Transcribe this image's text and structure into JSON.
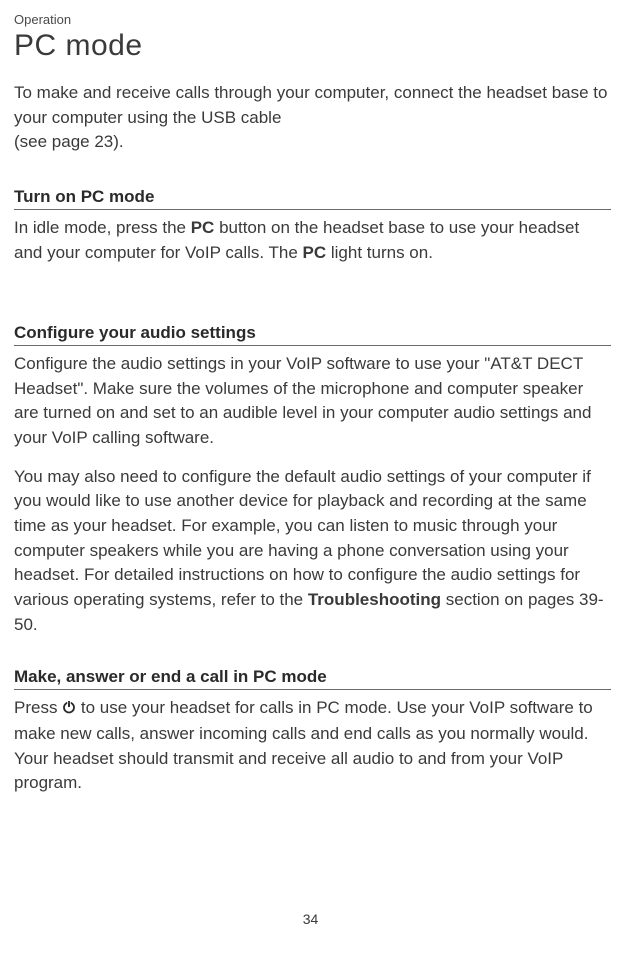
{
  "header": {
    "category": "Operation",
    "title": "PC mode"
  },
  "intro": "To make and receive calls through your computer, connect the headset base to your computer using the USB cable \n(see page 23).",
  "sections": {
    "turn_on": {
      "heading": "Turn on PC mode",
      "text_pre1": "In idle mode, press the ",
      "bold1": "PC",
      "text_mid": " button on the headset base to use your headset and your computer for VoIP calls. The ",
      "bold2": "PC",
      "text_post": " light turns on."
    },
    "configure": {
      "heading": "Configure your audio settings",
      "p1": "Configure the audio settings in your VoIP software to use your \"AT&T DECT Headset\". Make sure the volumes of the microphone and computer speaker are turned on and set to an audible level in your computer audio settings and your VoIP calling software.",
      "p2_pre": "You may also need to configure the default audio settings of your computer if you would like to use another device for playback and recording at the same time as your headset. For example, you can listen to music through your computer speakers while you are having a phone conversation using your headset. For detailed instructions on how to configure the audio settings for various operating systems, refer to the ",
      "p2_bold": "Troubleshooting",
      "p2_post": " section on pages 39-50."
    },
    "make_call": {
      "heading": "Make, answer or end a call in PC mode",
      "text_pre": "Press ",
      "text_post": " to use your headset for calls in PC mode. Use your VoIP software to make new calls, answer incoming calls and end calls as you normally would. Your headset should transmit and receive all audio to and from your VoIP program."
    }
  },
  "page_number": "34"
}
